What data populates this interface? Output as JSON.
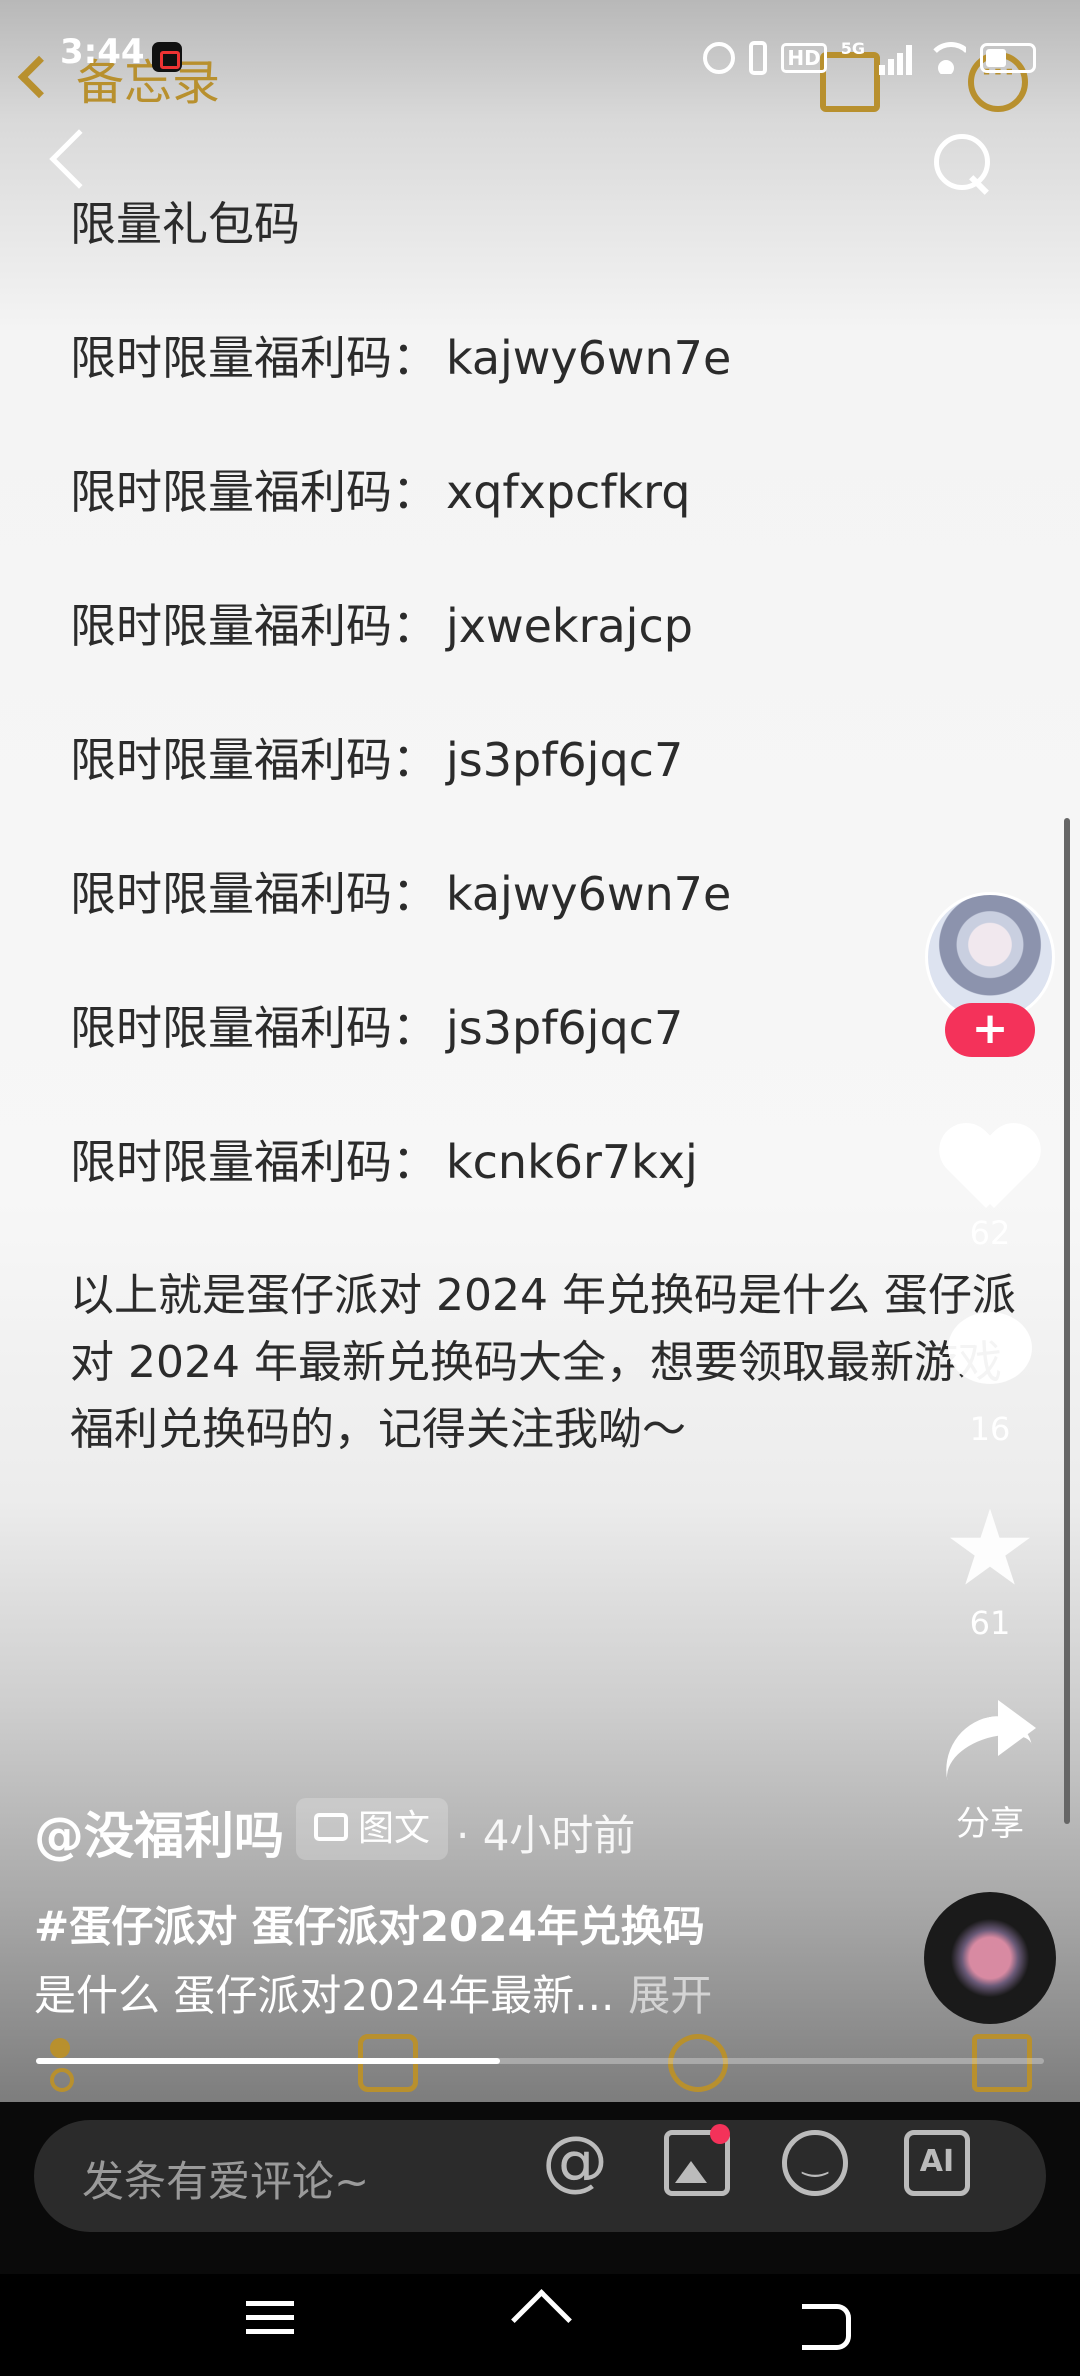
{
  "status_bar": {
    "time": "3:44",
    "network": "5G",
    "hd": "HD"
  },
  "memo_app": {
    "back_label": "备忘录"
  },
  "note": {
    "heading": "限量礼包码",
    "code_prefix": "限时限量福利码：",
    "codes": [
      "kajwy6wn7e",
      "xqfxpcfkrq",
      "jxwekrajcp",
      "js3pf6jqc7",
      "kajwy6wn7e",
      "js3pf6jqc7",
      "kcnk6r7kxj"
    ],
    "paragraph": "以上就是蛋仔派对 2024 年兑换码是什么 蛋仔派对 2024 年最新兑换码大全，想要领取最新游戏福利兑换码的，记得关注我呦～"
  },
  "actions": {
    "likes": "62",
    "comments": "16",
    "favorites": "61",
    "share_label": "分享",
    "follow_symbol": "+"
  },
  "post": {
    "author": "@没福利吗",
    "type_tag": "图文",
    "time": "· 4小时前",
    "caption_line1": "#蛋仔派对 蛋仔派对2024年兑换码",
    "caption_line2": "是什么 蛋仔派对2024年最新...",
    "expand_label": "展开"
  },
  "progress": {
    "fraction": 0.46
  },
  "comment_bar": {
    "placeholder": "发条有爱评论~",
    "ai_label": "AI"
  },
  "colors": {
    "accent": "#f4325a",
    "memo_gold": "#b8902e"
  }
}
